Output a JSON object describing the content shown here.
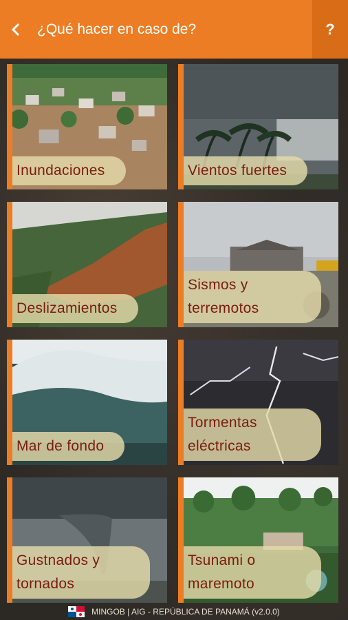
{
  "header": {
    "title": "¿Qué hacer en caso de?",
    "help_label": "?"
  },
  "cards": [
    {
      "label": "Inundaciones"
    },
    {
      "label": "Vientos fuertes"
    },
    {
      "label": "Deslizamientos"
    },
    {
      "label": "Sismos y terremotos"
    },
    {
      "label": "Mar de fondo"
    },
    {
      "label": "Tormentas eléctricas"
    },
    {
      "label": "Gustnados y tornados"
    },
    {
      "label": "Tsunami o maremoto"
    }
  ],
  "footer": {
    "text": "MINGOB | AIG - REPÚBLICA DE PANAMÁ (v2.0.0)"
  },
  "colors": {
    "header": "#ed7d24",
    "label_text": "#7a1c0f",
    "label_bg": "#e4daaa"
  }
}
